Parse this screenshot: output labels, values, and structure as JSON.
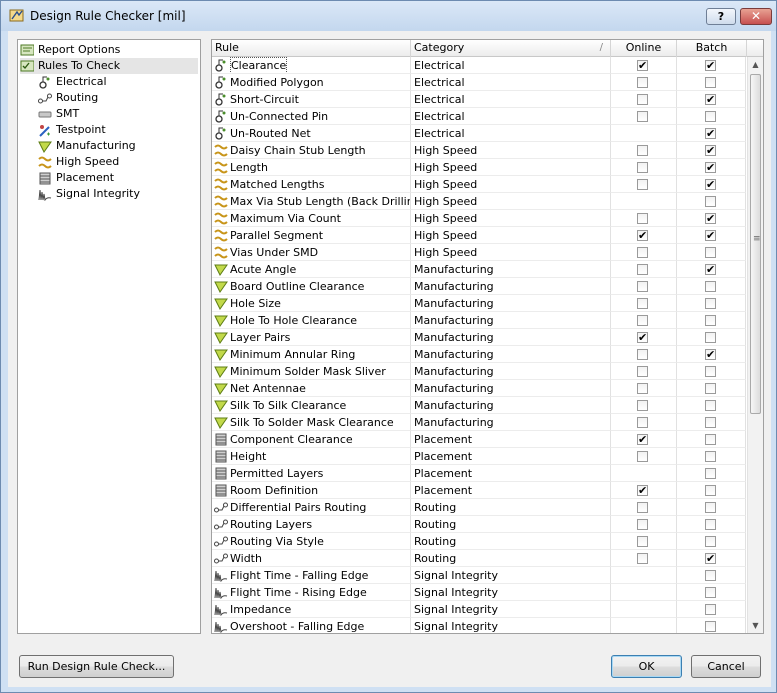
{
  "window": {
    "title": "Design Rule Checker [mil]",
    "help_label": "?",
    "close_label": "✕"
  },
  "tree": [
    {
      "label": "Report Options",
      "icon": "report-icon",
      "level": 0,
      "selected": false
    },
    {
      "label": "Rules To Check",
      "icon": "rules-icon",
      "level": 0,
      "selected": true
    },
    {
      "label": "Electrical",
      "icon": "electrical-icon",
      "level": 1,
      "selected": false
    },
    {
      "label": "Routing",
      "icon": "routing-icon",
      "level": 1,
      "selected": false
    },
    {
      "label": "SMT",
      "icon": "smt-icon",
      "level": 1,
      "selected": false
    },
    {
      "label": "Testpoint",
      "icon": "testpoint-icon",
      "level": 1,
      "selected": false
    },
    {
      "label": "Manufacturing",
      "icon": "manufacturing-icon",
      "level": 1,
      "selected": false
    },
    {
      "label": "High Speed",
      "icon": "high-speed-icon",
      "level": 1,
      "selected": false
    },
    {
      "label": "Placement",
      "icon": "placement-icon",
      "level": 1,
      "selected": false
    },
    {
      "label": "Signal Integrity",
      "icon": "signal-integrity-icon",
      "level": 1,
      "selected": false
    }
  ],
  "grid": {
    "columns": {
      "rule": "Rule",
      "category": "Category",
      "online": "Online",
      "batch": "Batch"
    },
    "sort_indicator": "/",
    "rows": [
      {
        "rule": "Clearance",
        "category": "Electrical",
        "online": true,
        "batch": true
      },
      {
        "rule": "Modified Polygon",
        "category": "Electrical",
        "online": false,
        "batch": false
      },
      {
        "rule": "Short-Circuit",
        "category": "Electrical",
        "online": false,
        "batch": true
      },
      {
        "rule": "Un-Connected Pin",
        "category": "Electrical",
        "online": false,
        "batch": false
      },
      {
        "rule": "Un-Routed Net",
        "category": "Electrical",
        "online": null,
        "batch": true
      },
      {
        "rule": "Daisy Chain Stub Length",
        "category": "High Speed",
        "online": false,
        "batch": true
      },
      {
        "rule": "Length",
        "category": "High Speed",
        "online": false,
        "batch": true
      },
      {
        "rule": "Matched Lengths",
        "category": "High Speed",
        "online": false,
        "batch": true
      },
      {
        "rule": "Max Via Stub Length (Back Drilling)",
        "category": "High Speed",
        "online": null,
        "batch": false
      },
      {
        "rule": "Maximum Via Count",
        "category": "High Speed",
        "online": false,
        "batch": true
      },
      {
        "rule": "Parallel Segment",
        "category": "High Speed",
        "online": true,
        "batch": true
      },
      {
        "rule": "Vias Under SMD",
        "category": "High Speed",
        "online": false,
        "batch": false
      },
      {
        "rule": "Acute Angle",
        "category": "Manufacturing",
        "online": false,
        "batch": true
      },
      {
        "rule": "Board Outline Clearance",
        "category": "Manufacturing",
        "online": false,
        "batch": false
      },
      {
        "rule": "Hole Size",
        "category": "Manufacturing",
        "online": false,
        "batch": false
      },
      {
        "rule": "Hole To Hole Clearance",
        "category": "Manufacturing",
        "online": false,
        "batch": false
      },
      {
        "rule": "Layer Pairs",
        "category": "Manufacturing",
        "online": true,
        "batch": false
      },
      {
        "rule": "Minimum Annular Ring",
        "category": "Manufacturing",
        "online": false,
        "batch": true
      },
      {
        "rule": "Minimum Solder Mask Sliver",
        "category": "Manufacturing",
        "online": false,
        "batch": false
      },
      {
        "rule": "Net Antennae",
        "category": "Manufacturing",
        "online": false,
        "batch": false
      },
      {
        "rule": "Silk To Silk Clearance",
        "category": "Manufacturing",
        "online": false,
        "batch": false
      },
      {
        "rule": "Silk To Solder Mask Clearance",
        "category": "Manufacturing",
        "online": false,
        "batch": false
      },
      {
        "rule": "Component Clearance",
        "category": "Placement",
        "online": true,
        "batch": false
      },
      {
        "rule": "Height",
        "category": "Placement",
        "online": false,
        "batch": false
      },
      {
        "rule": "Permitted Layers",
        "category": "Placement",
        "online": null,
        "batch": false
      },
      {
        "rule": "Room Definition",
        "category": "Placement",
        "online": true,
        "batch": false
      },
      {
        "rule": "Differential Pairs Routing",
        "category": "Routing",
        "online": false,
        "batch": false
      },
      {
        "rule": "Routing Layers",
        "category": "Routing",
        "online": false,
        "batch": false
      },
      {
        "rule": "Routing Via Style",
        "category": "Routing",
        "online": false,
        "batch": false
      },
      {
        "rule": "Width",
        "category": "Routing",
        "online": false,
        "batch": true
      },
      {
        "rule": "Flight Time - Falling Edge",
        "category": "Signal Integrity",
        "online": null,
        "batch": false
      },
      {
        "rule": "Flight Time - Rising Edge",
        "category": "Signal Integrity",
        "online": null,
        "batch": false
      },
      {
        "rule": "Impedance",
        "category": "Signal Integrity",
        "online": null,
        "batch": false
      },
      {
        "rule": "Overshoot - Falling Edge",
        "category": "Signal Integrity",
        "online": null,
        "batch": false
      }
    ]
  },
  "buttons": {
    "run": "Run Design Rule Check...",
    "ok": "OK",
    "cancel": "Cancel"
  },
  "colors": {
    "title_bar": "#c3d7ee",
    "close": "#c75050",
    "tree_selection": "#e5e5e5"
  }
}
